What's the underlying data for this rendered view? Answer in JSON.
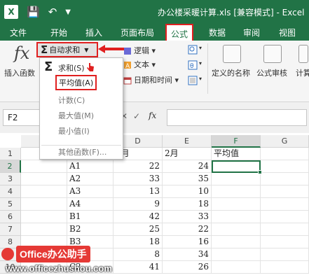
{
  "window": {
    "title": "办公楼采暖计算.xls  [兼容模式] - Excel",
    "app_icon_letter": "X",
    "save_icon": "save-icon",
    "undo_icon": "undo-icon",
    "qat_customize_icon": "chevron-down-icon"
  },
  "tabs": [
    "文件",
    "开始",
    "插入",
    "页面布局",
    "公式",
    "数据",
    "审阅",
    "视图"
  ],
  "active_tab": "公式",
  "ribbon": {
    "insert_function_label": "插入函数",
    "insert_function_glyph": "fx",
    "autosum_label": "自动求和",
    "logical_label": "逻辑",
    "text_label": "文本",
    "datetime_label": "日期和时间",
    "defined_names_label": "定义的名称",
    "formula_auditing_label": "公式审核",
    "calculation_label": "计算"
  },
  "autosum_menu": {
    "items": [
      "求和(S)",
      "平均值(A)",
      "计数(C)",
      "最大值(M)",
      "最小值(I)",
      "其他函数(F)..."
    ],
    "highlighted": "平均值(A)"
  },
  "formula_bar": {
    "name_box": "F2",
    "fx_glyph": "fx",
    "formula": ""
  },
  "columns": [
    "D",
    "E",
    "F",
    "G"
  ],
  "selected_column": "F",
  "rows": [
    {
      "num": "1",
      "a": "",
      "d": "1月",
      "e": "2月",
      "f": "平均值"
    },
    {
      "num": "2",
      "a": "A1",
      "d": "22",
      "e": "24",
      "f": ""
    },
    {
      "num": "3",
      "a": "A2",
      "d": "33",
      "e": "35",
      "f": ""
    },
    {
      "num": "4",
      "a": "A3",
      "d": "13",
      "e": "10",
      "f": ""
    },
    {
      "num": "5",
      "a": "A4",
      "d": "9",
      "e": "18",
      "f": ""
    },
    {
      "num": "6",
      "a": "B1",
      "d": "42",
      "e": "33",
      "f": ""
    },
    {
      "num": "7",
      "a": "B2",
      "d": "25",
      "e": "22",
      "f": ""
    },
    {
      "num": "8",
      "a": "B3",
      "d": "18",
      "e": "16",
      "f": ""
    },
    {
      "num": "9",
      "a": "",
      "d": "8",
      "e": "34",
      "f": ""
    },
    {
      "num": "10",
      "a": "C2",
      "d": "41",
      "e": "26",
      "f": ""
    }
  ],
  "active_cell": "F2",
  "watermark": {
    "brand": "Office办公助手",
    "url": "www.officezhushou.com"
  },
  "colors": {
    "excel_green": "#217346",
    "highlight_red": "#e02020"
  }
}
